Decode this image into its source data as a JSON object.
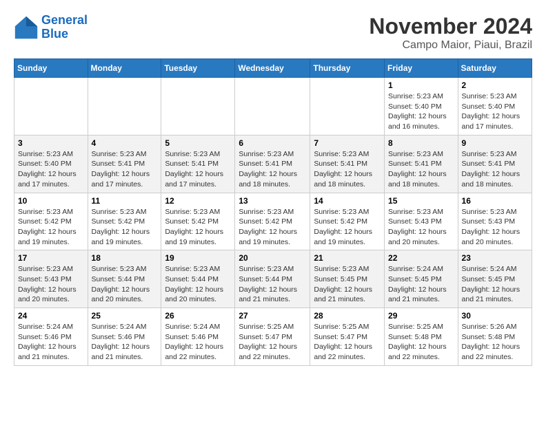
{
  "logo": {
    "line1": "General",
    "line2": "Blue"
  },
  "title": "November 2024",
  "location": "Campo Maior, Piaui, Brazil",
  "headers": [
    "Sunday",
    "Monday",
    "Tuesday",
    "Wednesday",
    "Thursday",
    "Friday",
    "Saturday"
  ],
  "weeks": [
    [
      {
        "day": "",
        "info": ""
      },
      {
        "day": "",
        "info": ""
      },
      {
        "day": "",
        "info": ""
      },
      {
        "day": "",
        "info": ""
      },
      {
        "day": "",
        "info": ""
      },
      {
        "day": "1",
        "info": "Sunrise: 5:23 AM\nSunset: 5:40 PM\nDaylight: 12 hours and 16 minutes."
      },
      {
        "day": "2",
        "info": "Sunrise: 5:23 AM\nSunset: 5:40 PM\nDaylight: 12 hours and 17 minutes."
      }
    ],
    [
      {
        "day": "3",
        "info": "Sunrise: 5:23 AM\nSunset: 5:40 PM\nDaylight: 12 hours and 17 minutes."
      },
      {
        "day": "4",
        "info": "Sunrise: 5:23 AM\nSunset: 5:41 PM\nDaylight: 12 hours and 17 minutes."
      },
      {
        "day": "5",
        "info": "Sunrise: 5:23 AM\nSunset: 5:41 PM\nDaylight: 12 hours and 17 minutes."
      },
      {
        "day": "6",
        "info": "Sunrise: 5:23 AM\nSunset: 5:41 PM\nDaylight: 12 hours and 18 minutes."
      },
      {
        "day": "7",
        "info": "Sunrise: 5:23 AM\nSunset: 5:41 PM\nDaylight: 12 hours and 18 minutes."
      },
      {
        "day": "8",
        "info": "Sunrise: 5:23 AM\nSunset: 5:41 PM\nDaylight: 12 hours and 18 minutes."
      },
      {
        "day": "9",
        "info": "Sunrise: 5:23 AM\nSunset: 5:41 PM\nDaylight: 12 hours and 18 minutes."
      }
    ],
    [
      {
        "day": "10",
        "info": "Sunrise: 5:23 AM\nSunset: 5:42 PM\nDaylight: 12 hours and 19 minutes."
      },
      {
        "day": "11",
        "info": "Sunrise: 5:23 AM\nSunset: 5:42 PM\nDaylight: 12 hours and 19 minutes."
      },
      {
        "day": "12",
        "info": "Sunrise: 5:23 AM\nSunset: 5:42 PM\nDaylight: 12 hours and 19 minutes."
      },
      {
        "day": "13",
        "info": "Sunrise: 5:23 AM\nSunset: 5:42 PM\nDaylight: 12 hours and 19 minutes."
      },
      {
        "day": "14",
        "info": "Sunrise: 5:23 AM\nSunset: 5:42 PM\nDaylight: 12 hours and 19 minutes."
      },
      {
        "day": "15",
        "info": "Sunrise: 5:23 AM\nSunset: 5:43 PM\nDaylight: 12 hours and 20 minutes."
      },
      {
        "day": "16",
        "info": "Sunrise: 5:23 AM\nSunset: 5:43 PM\nDaylight: 12 hours and 20 minutes."
      }
    ],
    [
      {
        "day": "17",
        "info": "Sunrise: 5:23 AM\nSunset: 5:43 PM\nDaylight: 12 hours and 20 minutes."
      },
      {
        "day": "18",
        "info": "Sunrise: 5:23 AM\nSunset: 5:44 PM\nDaylight: 12 hours and 20 minutes."
      },
      {
        "day": "19",
        "info": "Sunrise: 5:23 AM\nSunset: 5:44 PM\nDaylight: 12 hours and 20 minutes."
      },
      {
        "day": "20",
        "info": "Sunrise: 5:23 AM\nSunset: 5:44 PM\nDaylight: 12 hours and 21 minutes."
      },
      {
        "day": "21",
        "info": "Sunrise: 5:23 AM\nSunset: 5:45 PM\nDaylight: 12 hours and 21 minutes."
      },
      {
        "day": "22",
        "info": "Sunrise: 5:24 AM\nSunset: 5:45 PM\nDaylight: 12 hours and 21 minutes."
      },
      {
        "day": "23",
        "info": "Sunrise: 5:24 AM\nSunset: 5:45 PM\nDaylight: 12 hours and 21 minutes."
      }
    ],
    [
      {
        "day": "24",
        "info": "Sunrise: 5:24 AM\nSunset: 5:46 PM\nDaylight: 12 hours and 21 minutes."
      },
      {
        "day": "25",
        "info": "Sunrise: 5:24 AM\nSunset: 5:46 PM\nDaylight: 12 hours and 21 minutes."
      },
      {
        "day": "26",
        "info": "Sunrise: 5:24 AM\nSunset: 5:46 PM\nDaylight: 12 hours and 22 minutes."
      },
      {
        "day": "27",
        "info": "Sunrise: 5:25 AM\nSunset: 5:47 PM\nDaylight: 12 hours and 22 minutes."
      },
      {
        "day": "28",
        "info": "Sunrise: 5:25 AM\nSunset: 5:47 PM\nDaylight: 12 hours and 22 minutes."
      },
      {
        "day": "29",
        "info": "Sunrise: 5:25 AM\nSunset: 5:48 PM\nDaylight: 12 hours and 22 minutes."
      },
      {
        "day": "30",
        "info": "Sunrise: 5:26 AM\nSunset: 5:48 PM\nDaylight: 12 hours and 22 minutes."
      }
    ]
  ]
}
